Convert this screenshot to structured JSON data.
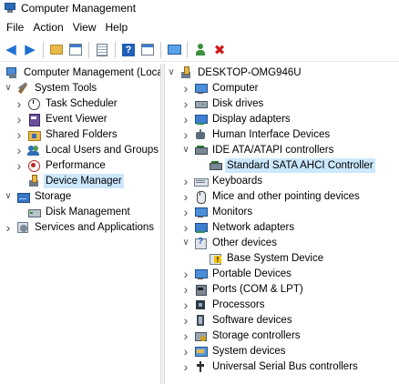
{
  "window": {
    "title": "Computer Management"
  },
  "menu": [
    "File",
    "Action",
    "View",
    "Help"
  ],
  "toolbar": [
    "back-icon",
    "forward-icon",
    "up-folder-icon",
    "show-hide-tree-icon",
    "properties-icon",
    "help-icon",
    "view-icon",
    "monitor-icon",
    "scan-hardware-icon",
    "uninstall-icon"
  ],
  "left_tree": [
    {
      "label": "Computer Management (Local",
      "icon": "computer-management-icon",
      "chevron": "",
      "depth": 0,
      "selected": false
    },
    {
      "label": "System Tools",
      "icon": "system-tools-icon",
      "chevron": "v",
      "depth": 1,
      "selected": false
    },
    {
      "label": "Task Scheduler",
      "icon": "task-scheduler-icon",
      "chevron": ">",
      "depth": 2,
      "selected": false
    },
    {
      "label": "Event Viewer",
      "icon": "event-viewer-icon",
      "chevron": ">",
      "depth": 2,
      "selected": false
    },
    {
      "label": "Shared Folders",
      "icon": "shared-folders-icon",
      "chevron": ">",
      "depth": 2,
      "selected": false
    },
    {
      "label": "Local Users and Groups",
      "icon": "local-users-icon",
      "chevron": ">",
      "depth": 2,
      "selected": false
    },
    {
      "label": "Performance",
      "icon": "performance-icon",
      "chevron": ">",
      "depth": 2,
      "selected": false
    },
    {
      "label": "Device Manager",
      "icon": "device-manager-icon",
      "chevron": "",
      "depth": 2,
      "selected": true
    },
    {
      "label": "Storage",
      "icon": "storage-icon",
      "chevron": "v",
      "depth": 1,
      "selected": false
    },
    {
      "label": "Disk Management",
      "icon": "disk-management-icon",
      "chevron": "",
      "depth": 2,
      "selected": false
    },
    {
      "label": "Services and Applications",
      "icon": "services-icon",
      "chevron": ">",
      "depth": 1,
      "selected": false
    }
  ],
  "device_tree": [
    {
      "label": "DESKTOP-OMG946U",
      "icon": "computer-icon",
      "chevron": "v",
      "depth": 0,
      "selected": false
    },
    {
      "label": "Computer",
      "icon": "monitor-icon",
      "chevron": ">",
      "depth": 1,
      "selected": false
    },
    {
      "label": "Disk drives",
      "icon": "disk-drive-icon",
      "chevron": ">",
      "depth": 1,
      "selected": false
    },
    {
      "label": "Display adapters",
      "icon": "display-adapter-icon",
      "chevron": ">",
      "depth": 1,
      "selected": false
    },
    {
      "label": "Human Interface Devices",
      "icon": "hid-icon",
      "chevron": ">",
      "depth": 1,
      "selected": false
    },
    {
      "label": "IDE ATA/ATAPI controllers",
      "icon": "ide-controller-icon",
      "chevron": "v",
      "depth": 1,
      "selected": false
    },
    {
      "label": "Standard SATA AHCI Controller",
      "icon": "sata-controller-icon",
      "chevron": "",
      "depth": 2,
      "selected": true
    },
    {
      "label": "Keyboards",
      "icon": "keyboard-icon",
      "chevron": ">",
      "depth": 1,
      "selected": false
    },
    {
      "label": "Mice and other pointing devices",
      "icon": "mouse-icon",
      "chevron": ">",
      "depth": 1,
      "selected": false
    },
    {
      "label": "Monitors",
      "icon": "monitors-icon",
      "chevron": ">",
      "depth": 1,
      "selected": false
    },
    {
      "label": "Network adapters",
      "icon": "network-adapter-icon",
      "chevron": ">",
      "depth": 1,
      "selected": false
    },
    {
      "label": "Other devices",
      "icon": "other-devices-icon",
      "chevron": "v",
      "depth": 1,
      "selected": false
    },
    {
      "label": "Base System Device",
      "icon": "warning-device-icon",
      "chevron": "",
      "depth": 2,
      "selected": false
    },
    {
      "label": "Portable Devices",
      "icon": "portable-devices-icon",
      "chevron": ">",
      "depth": 1,
      "selected": false
    },
    {
      "label": "Ports (COM & LPT)",
      "icon": "ports-icon",
      "chevron": ">",
      "depth": 1,
      "selected": false
    },
    {
      "label": "Processors",
      "icon": "processor-icon",
      "chevron": ">",
      "depth": 1,
      "selected": false
    },
    {
      "label": "Software devices",
      "icon": "software-device-icon",
      "chevron": ">",
      "depth": 1,
      "selected": false
    },
    {
      "label": "Storage controllers",
      "icon": "storage-controller-icon",
      "chevron": ">",
      "depth": 1,
      "selected": false
    },
    {
      "label": "System devices",
      "icon": "system-devices-icon",
      "chevron": ">",
      "depth": 1,
      "selected": false
    },
    {
      "label": "Universal Serial Bus controllers",
      "icon": "usb-icon",
      "chevron": ">",
      "depth": 1,
      "selected": false
    }
  ],
  "colors": {
    "selection": "#cce8ff",
    "accent": "#1f6fd1",
    "delete": "#d11a1a"
  }
}
